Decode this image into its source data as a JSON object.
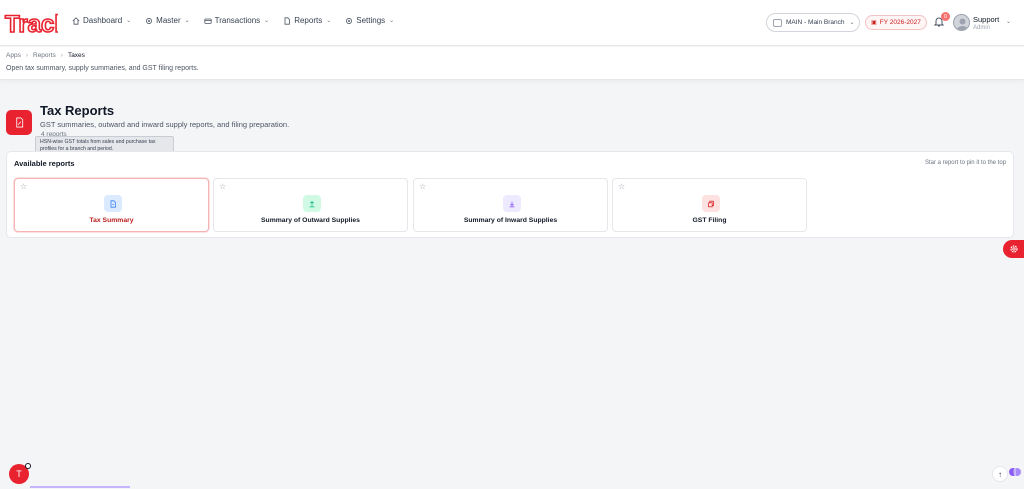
{
  "brand": {
    "logo_text": "Track",
    "accent": "#e8232f"
  },
  "nav": {
    "items": [
      {
        "label": "Dashboard",
        "icon": "home-icon"
      },
      {
        "label": "Master",
        "icon": "gear-icon"
      },
      {
        "label": "Transactions",
        "icon": "card-icon"
      },
      {
        "label": "Reports",
        "icon": "file-icon"
      },
      {
        "label": "Settings",
        "icon": "gear-icon"
      }
    ]
  },
  "header": {
    "branch": "MAIN - Main Branch",
    "fiscal_year": "FY 2026-2027",
    "notification_count": "0",
    "user_name": "Support",
    "user_role": "Admin"
  },
  "breadcrumb": {
    "items": [
      "Apps",
      "Reports",
      "Taxes"
    ]
  },
  "subtitle": "Open tax summary, supply summaries, and GST filing reports.",
  "page": {
    "title": "Tax Reports",
    "description": "GST summaries, outward and inward supply reports, and filing preparation.",
    "count": "4 reports",
    "tooltip": "HSN-wise GST totals from sales and purchase tax profiles for a branch and period."
  },
  "panel": {
    "title": "Available reports",
    "hint": "Star a report to pin it to the top"
  },
  "reports": [
    {
      "label": "Tax Summary",
      "icon": "document-icon",
      "icon_bg": "#dbeafe",
      "icon_color": "#3b82f6"
    },
    {
      "label": "Summary of Outward Supplies",
      "icon": "upload-icon",
      "icon_bg": "#d1fae5",
      "icon_color": "#10b981"
    },
    {
      "label": "Summary of Inward Supplies",
      "icon": "download-icon",
      "icon_bg": "#ede9fe",
      "icon_color": "#8b5cf6"
    },
    {
      "label": "GST Filing",
      "icon": "copy-icon",
      "icon_bg": "#fee2e2",
      "icon_color": "#dc2626"
    }
  ],
  "fab": {
    "label": "T"
  }
}
